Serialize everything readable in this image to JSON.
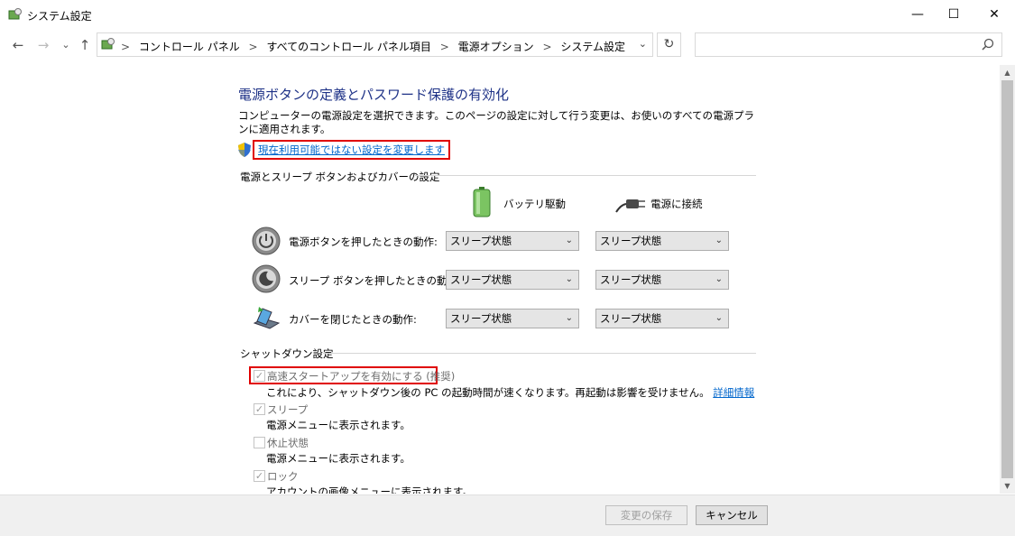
{
  "window": {
    "title": "システム設定",
    "minimize": "—",
    "maximize": "☐",
    "close": "✕"
  },
  "nav": {
    "back": "←",
    "forward": "→",
    "recent": "⌄",
    "up": "↑",
    "breadcrumbs": [
      "コントロール パネル",
      "すべてのコントロール パネル項目",
      "電源オプション",
      "システム設定"
    ],
    "separator": ">",
    "dropdown": "⌄",
    "refresh": "↻",
    "search_placeholder": ""
  },
  "page": {
    "heading": "電源ボタンの定義とパスワード保護の有効化",
    "description": "コンピューターの電源設定を選択できます。このページの設定に対して行う変更は、お使いのすべての電源プランに適用されます。",
    "change_link": "現在利用可能ではない設定を変更します"
  },
  "power_group": {
    "title": "電源とスリープ ボタンおよびカバーの設定",
    "col_battery": "バッテリ駆動",
    "col_plugged": "電源に接続",
    "rows": [
      {
        "label": "電源ボタンを押したときの動作:",
        "battery": "スリープ状態",
        "plugged": "スリープ状態"
      },
      {
        "label": "スリープ ボタンを押したときの動作:",
        "battery": "スリープ状態",
        "plugged": "スリープ状態"
      },
      {
        "label": "カバーを閉じたときの動作:",
        "battery": "スリープ状態",
        "plugged": "スリープ状態"
      }
    ]
  },
  "shutdown_group": {
    "title": "シャットダウン設定",
    "items": [
      {
        "label": "高速スタートアップを有効にする (推奨)",
        "checked": true,
        "desc": "これにより、シャットダウン後の PC の起動時間が速くなります。再起動は影響を受けません。",
        "link": "詳細情報"
      },
      {
        "label": "スリープ",
        "checked": true,
        "desc": "電源メニューに表示されます。"
      },
      {
        "label": "休止状態",
        "checked": false,
        "desc": "電源メニューに表示されます。"
      },
      {
        "label": "ロック",
        "checked": true,
        "desc": "アカウントの画像メニューに表示されます。"
      }
    ]
  },
  "footer": {
    "save": "変更の保存",
    "cancel": "キャンセル"
  },
  "colors": {
    "heading": "#1e3287",
    "link": "#0066cc",
    "highlight": "#e00000"
  }
}
